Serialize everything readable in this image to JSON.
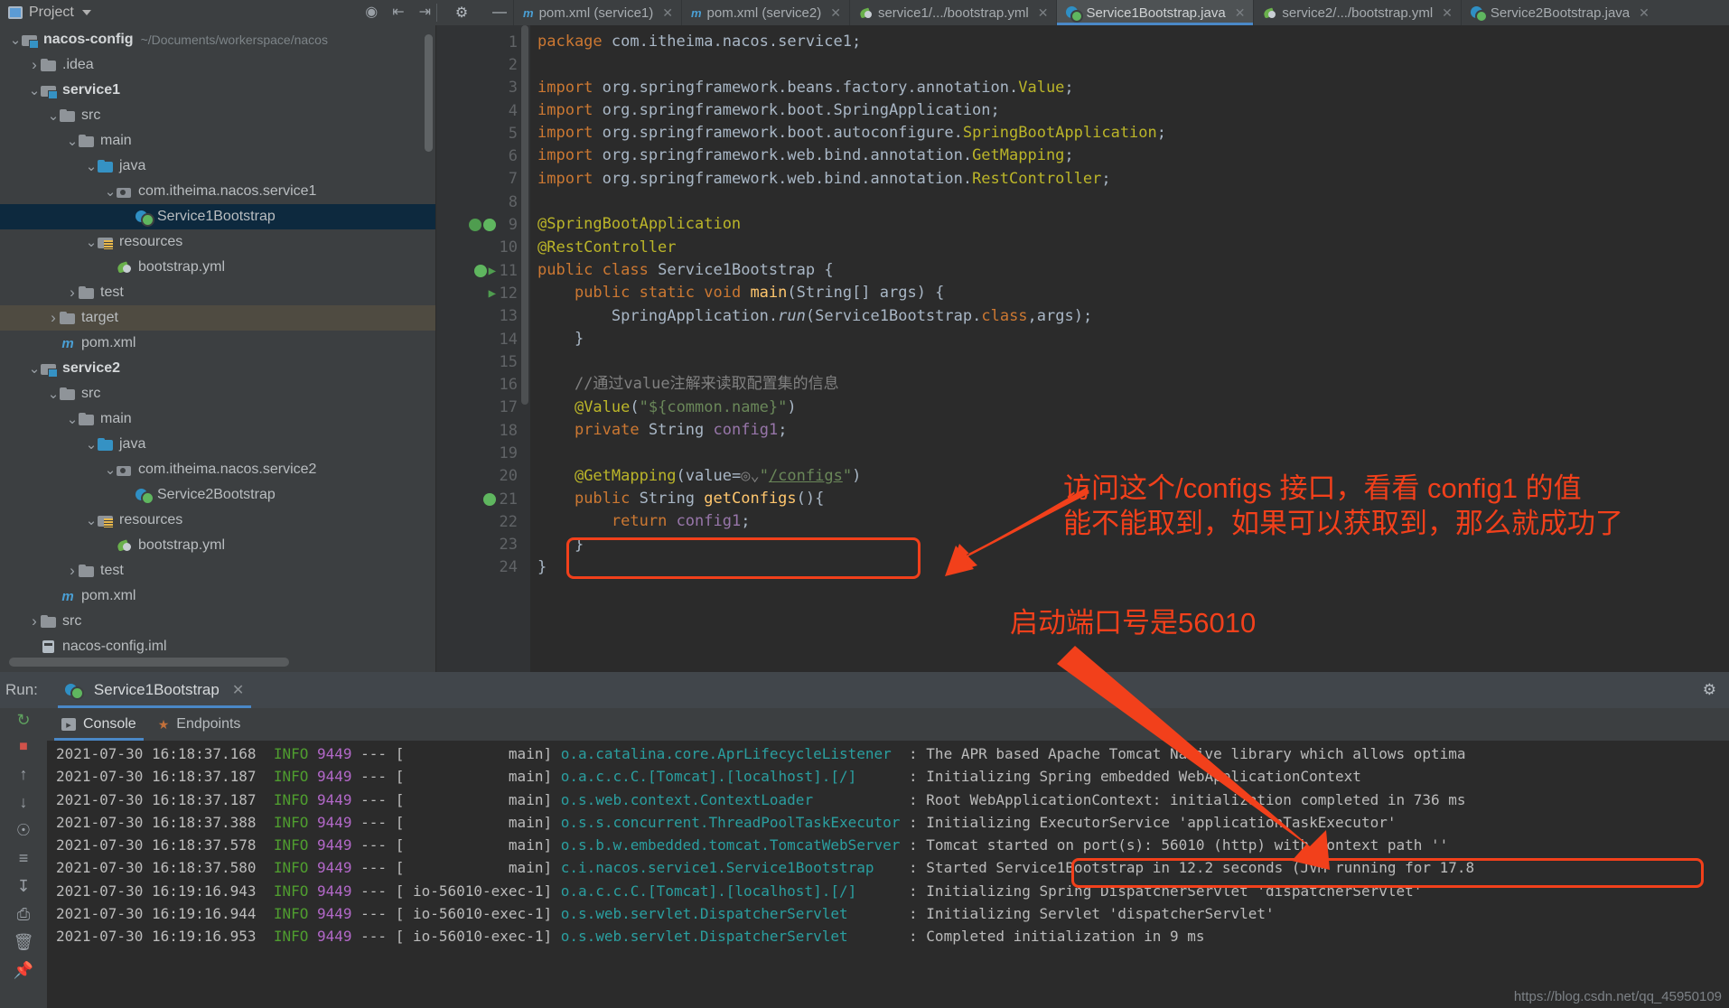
{
  "window": {
    "project_panel_title": "Project",
    "gear_icon": "gear-icon",
    "minimize_icon": "minimize-icon",
    "locate_icon": "locate-file-icon",
    "expand_icon": "expand-all-icon",
    "collapse_icon": "collapse-all-icon"
  },
  "editor_tabs": [
    {
      "label": "pom.xml (service1)",
      "icon": "maven-icon",
      "active": false
    },
    {
      "label": "pom.xml (service2)",
      "icon": "maven-icon",
      "active": false
    },
    {
      "label": "service1/.../bootstrap.yml",
      "icon": "yaml-icon",
      "active": false
    },
    {
      "label": "Service1Bootstrap.java",
      "icon": "java-spring-icon",
      "active": true
    },
    {
      "label": "service2/.../bootstrap.yml",
      "icon": "yaml-icon",
      "active": false
    },
    {
      "label": "Service2Bootstrap.java",
      "icon": "java-spring-icon",
      "active": false
    }
  ],
  "project_tree": [
    {
      "depth": 0,
      "arrow": "v",
      "icon": "module-icon",
      "label": "nacos-config",
      "bold": true,
      "suffix": "~/Documents/workerspace/nacos",
      "state": ""
    },
    {
      "depth": 1,
      "arrow": ">",
      "icon": "folder-icon",
      "label": ".idea",
      "bold": false,
      "suffix": "",
      "state": ""
    },
    {
      "depth": 1,
      "arrow": "v",
      "icon": "module-icon",
      "label": "service1",
      "bold": true,
      "suffix": "",
      "state": ""
    },
    {
      "depth": 2,
      "arrow": "v",
      "icon": "folder-icon",
      "label": "src",
      "bold": false,
      "suffix": "",
      "state": ""
    },
    {
      "depth": 3,
      "arrow": "v",
      "icon": "folder-icon",
      "label": "main",
      "bold": false,
      "suffix": "",
      "state": ""
    },
    {
      "depth": 4,
      "arrow": "v",
      "icon": "source-root-icon",
      "label": "java",
      "bold": false,
      "suffix": "",
      "state": ""
    },
    {
      "depth": 5,
      "arrow": "v",
      "icon": "package-icon",
      "label": "com.itheima.nacos.service1",
      "bold": false,
      "suffix": "",
      "state": ""
    },
    {
      "depth": 6,
      "arrow": "",
      "icon": "java-spring-icon",
      "label": "Service1Bootstrap",
      "bold": false,
      "suffix": "",
      "state": "selected"
    },
    {
      "depth": 4,
      "arrow": "v",
      "icon": "resources-icon",
      "label": "resources",
      "bold": false,
      "suffix": "",
      "state": ""
    },
    {
      "depth": 5,
      "arrow": "",
      "icon": "yaml-icon",
      "label": "bootstrap.yml",
      "bold": false,
      "suffix": "",
      "state": ""
    },
    {
      "depth": 3,
      "arrow": ">",
      "icon": "folder-icon",
      "label": "test",
      "bold": false,
      "suffix": "",
      "state": ""
    },
    {
      "depth": 2,
      "arrow": ">",
      "icon": "folder-icon",
      "label": "target",
      "bold": false,
      "suffix": "",
      "state": "highlight"
    },
    {
      "depth": 2,
      "arrow": "",
      "icon": "maven-icon",
      "label": "pom.xml",
      "bold": false,
      "suffix": "",
      "state": ""
    },
    {
      "depth": 1,
      "arrow": "v",
      "icon": "module-icon",
      "label": "service2",
      "bold": true,
      "suffix": "",
      "state": ""
    },
    {
      "depth": 2,
      "arrow": "v",
      "icon": "folder-icon",
      "label": "src",
      "bold": false,
      "suffix": "",
      "state": ""
    },
    {
      "depth": 3,
      "arrow": "v",
      "icon": "folder-icon",
      "label": "main",
      "bold": false,
      "suffix": "",
      "state": ""
    },
    {
      "depth": 4,
      "arrow": "v",
      "icon": "source-root-icon",
      "label": "java",
      "bold": false,
      "suffix": "",
      "state": ""
    },
    {
      "depth": 5,
      "arrow": "v",
      "icon": "package-icon",
      "label": "com.itheima.nacos.service2",
      "bold": false,
      "suffix": "",
      "state": ""
    },
    {
      "depth": 6,
      "arrow": "",
      "icon": "java-spring-icon",
      "label": "Service2Bootstrap",
      "bold": false,
      "suffix": "",
      "state": ""
    },
    {
      "depth": 4,
      "arrow": "v",
      "icon": "resources-icon",
      "label": "resources",
      "bold": false,
      "suffix": "",
      "state": ""
    },
    {
      "depth": 5,
      "arrow": "",
      "icon": "yaml-icon",
      "label": "bootstrap.yml",
      "bold": false,
      "suffix": "",
      "state": ""
    },
    {
      "depth": 3,
      "arrow": ">",
      "icon": "folder-icon",
      "label": "test",
      "bold": false,
      "suffix": "",
      "state": ""
    },
    {
      "depth": 2,
      "arrow": "",
      "icon": "maven-icon",
      "label": "pom.xml",
      "bold": false,
      "suffix": "",
      "state": ""
    },
    {
      "depth": 1,
      "arrow": ">",
      "icon": "folder-icon",
      "label": "src",
      "bold": false,
      "suffix": "",
      "state": ""
    },
    {
      "depth": 1,
      "arrow": "",
      "icon": "iml-icon",
      "label": "nacos-config.iml",
      "bold": false,
      "suffix": "",
      "state": ""
    }
  ],
  "code": {
    "first_line_number": 1,
    "lines": [
      {
        "n": 1,
        "html": "<span class='kw'>package</span> com.itheima.nacos.service1;"
      },
      {
        "n": 2,
        "html": ""
      },
      {
        "n": 3,
        "html": "<span class='kw'>import</span> org.springframework.beans.factory.annotation.<span class='ann'>Value</span>;"
      },
      {
        "n": 4,
        "html": "<span class='kw'>import</span> org.springframework.boot.<span class='cls'>SpringApplication</span>;"
      },
      {
        "n": 5,
        "html": "<span class='kw'>import</span> org.springframework.boot.autoconfigure.<span class='ann'>SpringBootApplication</span>;"
      },
      {
        "n": 6,
        "html": "<span class='kw'>import</span> org.springframework.web.bind.annotation.<span class='ann'>GetMapping</span>;"
      },
      {
        "n": 7,
        "html": "<span class='kw'>import</span> org.springframework.web.bind.annotation.<span class='ann'>RestController</span>;"
      },
      {
        "n": 8,
        "html": ""
      },
      {
        "n": 9,
        "html": "<span class='ann'>@SpringBootApplication</span>"
      },
      {
        "n": 10,
        "html": "<span class='ann'>@RestController</span>"
      },
      {
        "n": 11,
        "html": "<span class='kw'>public class</span> <span class='cls'>Service1Bootstrap</span> {"
      },
      {
        "n": 12,
        "html": "    <span class='kw'>public static void</span> <span class='mth'>main</span>(<span class='cls'>String</span>[] args) {"
      },
      {
        "n": 13,
        "html": "        <span class='cls'>SpringApplication</span>.<span class='ital'>run</span>(<span class='cls'>Service1Bootstrap</span>.<span class='kw'>class</span>,args);"
      },
      {
        "n": 14,
        "html": "    }"
      },
      {
        "n": 15,
        "html": ""
      },
      {
        "n": 16,
        "html": "    <span class='cmt'>//通过value注解来读取配置集的信息</span>"
      },
      {
        "n": 17,
        "html": "    <span class='ann'>@Value</span>(<span class='str'>\"${common.name}\"</span>)"
      },
      {
        "n": 18,
        "html": "    <span class='kw'>private</span> <span class='cls'>String</span> <span class='fld'>config1</span>;"
      },
      {
        "n": 19,
        "html": ""
      },
      {
        "n": 20,
        "html": "    <span class='ann'>@GetMapping</span>(value=<span class='cmt'>◎⌄</span><span class='str'>\"</span><span class='link'>/configs</span><span class='str'>\"</span>)"
      },
      {
        "n": 21,
        "html": "    <span class='kw'>public</span> <span class='cls'>String</span> <span class='mth'>getConfigs</span>(){"
      },
      {
        "n": 22,
        "html": "        <span class='kw'>return</span> <span class='fld'>config1</span>;"
      },
      {
        "n": 23,
        "html": "    }"
      },
      {
        "n": 24,
        "html": "}"
      }
    ],
    "gutter_markers": {
      "9": [
        "bean-icon",
        "inspection-icon"
      ],
      "11": [
        "spring-bean-icon",
        "run-icon"
      ],
      "12": [
        "run-icon"
      ],
      "21": [
        "spring-bean-icon"
      ]
    }
  },
  "annotations": {
    "line1": "访问这个/configs 接口，看看 config1 的值",
    "line2": "能不能取到，如果可以获取到，那么就成功了",
    "port_note": "启动端口号是56010",
    "color": "#f2401b"
  },
  "run_panel": {
    "run_label": "Run:",
    "run_tab_label": "Service1Bootstrap",
    "close_icon": "close-icon",
    "settings_icon": "gear-icon",
    "sub_tabs": [
      {
        "label": "Console",
        "icon": "console-icon",
        "active": true
      },
      {
        "label": "Endpoints",
        "icon": "endpoints-icon",
        "active": false
      }
    ],
    "side_buttons": [
      "rerun-icon",
      "scroll-up-icon",
      "scroll-down-icon",
      "camera-icon",
      "soft-wrap-icon",
      "scroll-to-end-icon",
      "print-icon",
      "clear-all-icon",
      "pin-icon"
    ],
    "watermark": "https://blog.csdn.net/qq_45950109"
  },
  "console_lines": [
    {
      "time": "2021-07-30 16:18:37.168",
      "level": "INFO",
      "pid": "9449",
      "thread": "main",
      "logger": "o.a.catalina.core.AprLifecycleListener",
      "message": "The APR based Apache Tomcat Native library which allows optima",
      "partial": true
    },
    {
      "time": "2021-07-30 16:18:37.187",
      "level": "INFO",
      "pid": "9449",
      "thread": "main",
      "logger": "o.a.c.c.C.[Tomcat].[localhost].[/]",
      "message": "Initializing Spring embedded WebApplicationContext",
      "partial": false
    },
    {
      "time": "2021-07-30 16:18:37.187",
      "level": "INFO",
      "pid": "9449",
      "thread": "main",
      "logger": "o.s.web.context.ContextLoader",
      "message": "Root WebApplicationContext: initialization completed in 736 ms",
      "partial": false
    },
    {
      "time": "2021-07-30 16:18:37.388",
      "level": "INFO",
      "pid": "9449",
      "thread": "main",
      "logger": "o.s.s.concurrent.ThreadPoolTaskExecutor",
      "message": "Initializing ExecutorService 'applicationTaskExecutor'",
      "partial": false
    },
    {
      "time": "2021-07-30 16:18:37.578",
      "level": "INFO",
      "pid": "9449",
      "thread": "main",
      "logger": "o.s.b.w.embedded.tomcat.TomcatWebServer",
      "message": "Tomcat started on port(s): 56010 (http) with context path ''",
      "partial": false,
      "highlight": true
    },
    {
      "time": "2021-07-30 16:18:37.580",
      "level": "INFO",
      "pid": "9449",
      "thread": "main",
      "logger": "c.i.nacos.service1.Service1Bootstrap",
      "message": "Started Service1Bootstrap in 12.2 seconds (JVM running for 17.8",
      "partial": true
    },
    {
      "time": "2021-07-30 16:19:16.943",
      "level": "INFO",
      "pid": "9449",
      "thread": "io-56010-exec-1",
      "logger": "o.a.c.c.C.[Tomcat].[localhost].[/]",
      "message": "Initializing Spring DispatcherServlet 'dispatcherServlet'",
      "partial": false
    },
    {
      "time": "2021-07-30 16:19:16.944",
      "level": "INFO",
      "pid": "9449",
      "thread": "io-56010-exec-1",
      "logger": "o.s.web.servlet.DispatcherServlet",
      "message": "Initializing Servlet 'dispatcherServlet'",
      "partial": false
    },
    {
      "time": "2021-07-30 16:19:16.953",
      "level": "INFO",
      "pid": "9449",
      "thread": "io-56010-exec-1",
      "logger": "o.s.web.servlet.DispatcherServlet",
      "message": "Completed initialization in 9 ms",
      "partial": false
    }
  ]
}
